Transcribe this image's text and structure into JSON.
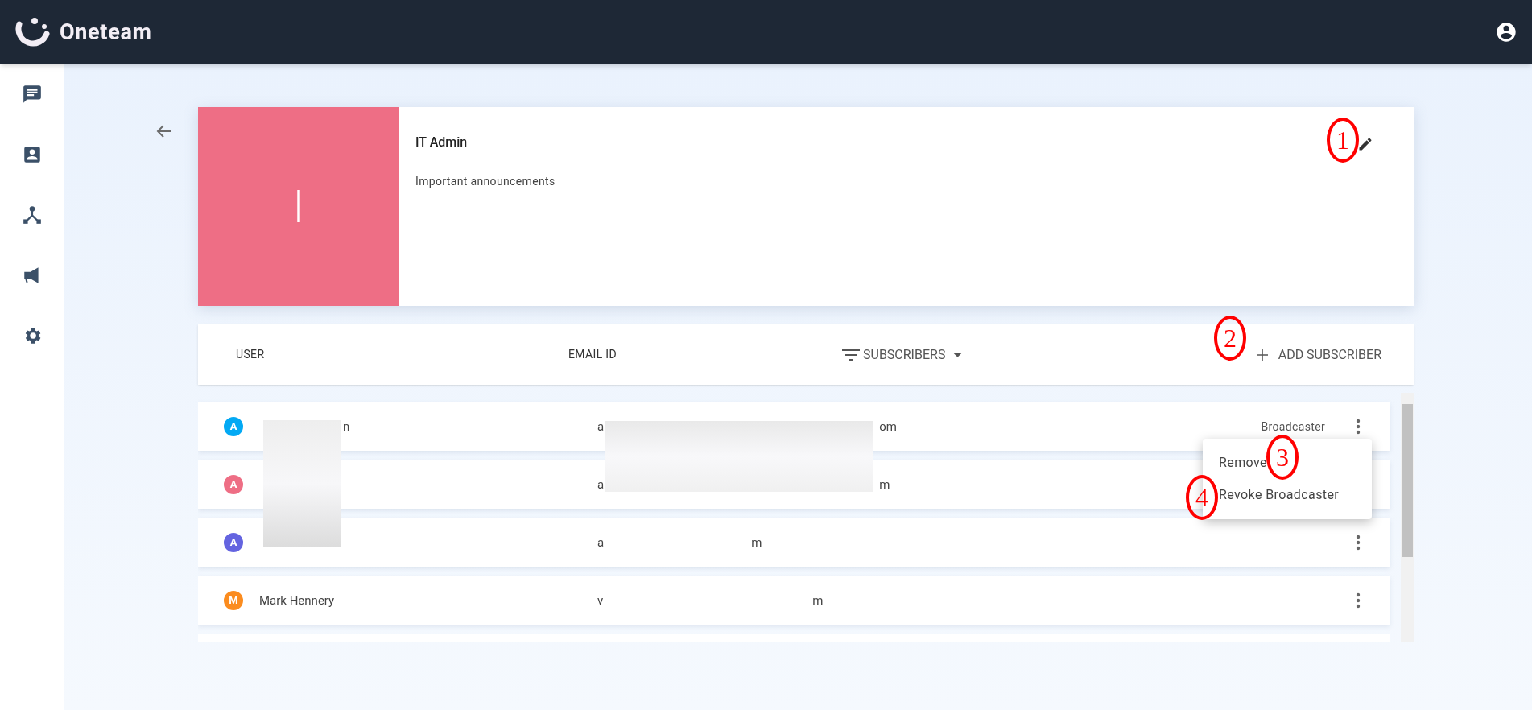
{
  "app": {
    "name": "Oneteam"
  },
  "sidebar": {
    "items": [
      {
        "kind": "chat"
      },
      {
        "kind": "contacts"
      },
      {
        "kind": "network"
      },
      {
        "kind": "broadcast"
      },
      {
        "kind": "settings"
      }
    ]
  },
  "group": {
    "initial": "I",
    "title": "IT Admin",
    "description": "Important announcements"
  },
  "table": {
    "columns": [
      {
        "kind": "text",
        "label": "USER"
      },
      {
        "kind": "text",
        "label": "EMAIL ID"
      },
      {
        "kind": "filter",
        "label": "SUBSCRIBERS"
      }
    ],
    "add_button": "ADD SUBSCRIBER",
    "rows": [
      {
        "initial": "A",
        "color": "#03a9f4",
        "name": "n",
        "email_start": "a",
        "email_end": "om",
        "role": "Broadcaster",
        "more_button": true
      },
      {
        "initial": "A",
        "color": "#ee6e85",
        "email_start": "a",
        "email_end": "m",
        "more_button": false
      },
      {
        "initial": "A",
        "color": "#6464e0",
        "email_start": "a",
        "email_end": "m",
        "more_button": true
      },
      {
        "initial": "M",
        "color": "#fb8c1f",
        "name": "Mark Hennery",
        "email_start": "v",
        "email_end": "m",
        "more_button": true
      }
    ]
  },
  "menu": {
    "items": [
      "Remove",
      "Revoke Broadcaster"
    ]
  },
  "annotations": [
    "1",
    "2",
    "3",
    "4"
  ]
}
